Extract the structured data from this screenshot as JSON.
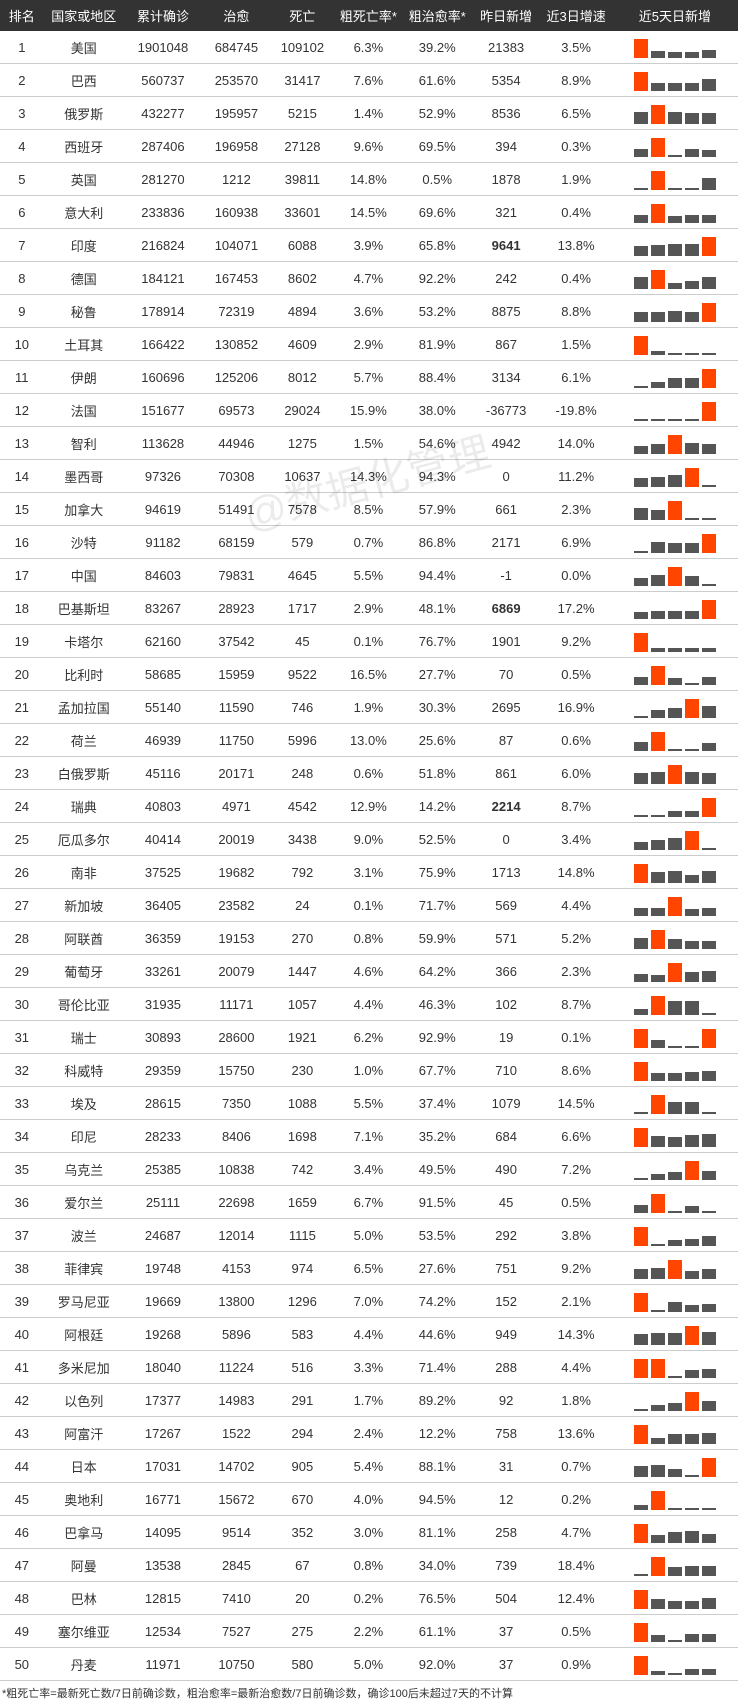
{
  "headers": [
    "排名",
    "国家或地区",
    "累计确诊",
    "治愈",
    "死亡",
    "粗死亡率*",
    "粗治愈率*",
    "昨日新增",
    "近3日增速",
    "近5天日新增"
  ],
  "footnote": "*粗死亡率=最新死亡数/7日前确诊数，粗治愈率=最新治愈数/7日前确诊数，确诊100后未超过7天的不计算",
  "rows": [
    {
      "rank": 1,
      "country": "美国",
      "conf": "1901048",
      "cure": "684745",
      "death": "109102",
      "drate": "6.3%",
      "crate": "39.2%",
      "new": "21383",
      "speed": "3.5%",
      "spark": [
        95,
        35,
        30,
        32,
        40
      ]
    },
    {
      "rank": 2,
      "country": "巴西",
      "conf": "560737",
      "cure": "253570",
      "death": "31417",
      "drate": "7.6%",
      "crate": "61.6%",
      "new": "5354",
      "speed": "8.9%",
      "spark": [
        95,
        38,
        42,
        40,
        60
      ]
    },
    {
      "rank": 3,
      "country": "俄罗斯",
      "conf": "432277",
      "cure": "195957",
      "death": "5215",
      "drate": "1.4%",
      "crate": "52.9%",
      "new": "8536",
      "speed": "6.5%",
      "spark": [
        60,
        95,
        58,
        56,
        55
      ]
    },
    {
      "rank": 4,
      "country": "西班牙",
      "conf": "287406",
      "cure": "196958",
      "death": "27128",
      "drate": "9.6%",
      "crate": "69.5%",
      "new": "394",
      "speed": "0.3%",
      "spark": [
        40,
        95,
        10,
        38,
        35
      ]
    },
    {
      "rank": 5,
      "country": "英国",
      "conf": "281270",
      "cure": "1212",
      "death": "39811",
      "drate": "14.8%",
      "crate": "0.5%",
      "new": "1878",
      "speed": "1.9%",
      "spark": [
        8,
        95,
        8,
        8,
        60
      ]
    },
    {
      "rank": 6,
      "country": "意大利",
      "conf": "233836",
      "cure": "160938",
      "death": "33601",
      "drate": "14.5%",
      "crate": "69.6%",
      "new": "321",
      "speed": "0.4%",
      "spark": [
        40,
        95,
        35,
        38,
        42
      ]
    },
    {
      "rank": 7,
      "country": "印度",
      "conf": "216824",
      "cure": "104071",
      "death": "6088",
      "drate": "3.9%",
      "crate": "65.8%",
      "new": "9641",
      "nb": true,
      "speed": "13.8%",
      "spark": [
        50,
        55,
        58,
        60,
        95
      ]
    },
    {
      "rank": 8,
      "country": "德国",
      "conf": "184121",
      "cure": "167453",
      "death": "8602",
      "drate": "4.7%",
      "crate": "92.2%",
      "new": "242",
      "speed": "0.4%",
      "spark": [
        62,
        95,
        30,
        40,
        58
      ]
    },
    {
      "rank": 9,
      "country": "秘鲁",
      "conf": "178914",
      "cure": "72319",
      "death": "4894",
      "drate": "3.6%",
      "crate": "53.2%",
      "new": "8875",
      "speed": "8.8%",
      "spark": [
        48,
        50,
        55,
        52,
        95
      ]
    },
    {
      "rank": 10,
      "country": "土耳其",
      "conf": "166422",
      "cure": "130852",
      "death": "4609",
      "drate": "2.9%",
      "crate": "81.9%",
      "new": "867",
      "speed": "1.5%",
      "spark": [
        95,
        18,
        10,
        8,
        8
      ]
    },
    {
      "rank": 11,
      "country": "伊朗",
      "conf": "160696",
      "cure": "125206",
      "death": "8012",
      "drate": "5.7%",
      "crate": "88.4%",
      "new": "3134",
      "speed": "6.1%",
      "spark": [
        8,
        32,
        50,
        52,
        95
      ]
    },
    {
      "rank": 12,
      "country": "法国",
      "conf": "151677",
      "cure": "69573",
      "death": "29024",
      "drate": "15.9%",
      "crate": "38.0%",
      "new": "-36773",
      "speed": "-19.8%",
      "spark": [
        0,
        0,
        0,
        0,
        95
      ]
    },
    {
      "rank": 13,
      "country": "智利",
      "conf": "113628",
      "cure": "44946",
      "death": "1275",
      "drate": "1.5%",
      "crate": "54.6%",
      "new": "4942",
      "speed": "14.0%",
      "spark": [
        40,
        50,
        95,
        55,
        48
      ]
    },
    {
      "rank": 14,
      "country": "墨西哥",
      "conf": "97326",
      "cure": "70308",
      "death": "10637",
      "drate": "14.3%",
      "crate": "94.3%",
      "new": "0",
      "speed": "11.2%",
      "spark": [
        45,
        50,
        60,
        95,
        8
      ]
    },
    {
      "rank": 15,
      "country": "加拿大",
      "conf": "94619",
      "cure": "51491",
      "death": "7578",
      "drate": "8.5%",
      "crate": "57.9%",
      "new": "661",
      "speed": "2.3%",
      "spark": [
        60,
        50,
        95,
        8,
        8
      ]
    },
    {
      "rank": 16,
      "country": "沙特",
      "conf": "91182",
      "cure": "68159",
      "death": "579",
      "drate": "0.7%",
      "crate": "86.8%",
      "new": "2171",
      "speed": "6.9%",
      "spark": [
        8,
        55,
        50,
        52,
        95
      ]
    },
    {
      "rank": 17,
      "country": "中国",
      "conf": "84603",
      "cure": "79831",
      "death": "4645",
      "drate": "5.5%",
      "crate": "94.4%",
      "new": "-1",
      "speed": "0.0%",
      "spark": [
        40,
        55,
        95,
        50,
        0
      ]
    },
    {
      "rank": 18,
      "country": "巴基斯坦",
      "conf": "83267",
      "cure": "28923",
      "death": "1717",
      "drate": "2.9%",
      "crate": "48.1%",
      "new": "6869",
      "nb": true,
      "speed": "17.2%",
      "spark": [
        35,
        40,
        38,
        42,
        95
      ]
    },
    {
      "rank": 19,
      "country": "卡塔尔",
      "conf": "62160",
      "cure": "37542",
      "death": "45",
      "drate": "0.1%",
      "crate": "76.7%",
      "new": "1901",
      "speed": "9.2%",
      "spark": [
        95,
        22,
        18,
        20,
        20
      ]
    },
    {
      "rank": 20,
      "country": "比利时",
      "conf": "58685",
      "cure": "15959",
      "death": "9522",
      "drate": "16.5%",
      "crate": "27.7%",
      "new": "70",
      "speed": "0.5%",
      "spark": [
        40,
        95,
        35,
        8,
        38
      ]
    },
    {
      "rank": 21,
      "country": "孟加拉国",
      "conf": "55140",
      "cure": "11590",
      "death": "746",
      "drate": "1.9%",
      "crate": "30.3%",
      "new": "2695",
      "speed": "16.9%",
      "spark": [
        8,
        40,
        50,
        95,
        60
      ]
    },
    {
      "rank": 22,
      "country": "荷兰",
      "conf": "46939",
      "cure": "11750",
      "death": "5996",
      "drate": "13.0%",
      "crate": "25.6%",
      "new": "87",
      "speed": "0.6%",
      "spark": [
        45,
        95,
        8,
        8,
        42
      ]
    },
    {
      "rank": 23,
      "country": "白俄罗斯",
      "conf": "45116",
      "cure": "20171",
      "death": "248",
      "drate": "0.6%",
      "crate": "51.8%",
      "new": "861",
      "speed": "6.0%",
      "spark": [
        55,
        60,
        95,
        58,
        55
      ]
    },
    {
      "rank": 24,
      "country": "瑞典",
      "conf": "40803",
      "cure": "4971",
      "death": "4542",
      "drate": "12.9%",
      "crate": "14.2%",
      "new": "2214",
      "nb": true,
      "speed": "8.7%",
      "spark": [
        8,
        8,
        30,
        28,
        95
      ]
    },
    {
      "rank": 25,
      "country": "厄瓜多尔",
      "conf": "40414",
      "cure": "20019",
      "death": "3438",
      "drate": "9.0%",
      "crate": "52.5%",
      "new": "0",
      "speed": "3.4%",
      "spark": [
        40,
        50,
        60,
        95,
        0
      ]
    },
    {
      "rank": 26,
      "country": "南非",
      "conf": "37525",
      "cure": "19682",
      "death": "792",
      "drate": "3.1%",
      "crate": "75.9%",
      "new": "1713",
      "speed": "14.8%",
      "spark": [
        95,
        55,
        58,
        40,
        62
      ]
    },
    {
      "rank": 27,
      "country": "新加坡",
      "conf": "36405",
      "cure": "23582",
      "death": "24",
      "drate": "0.1%",
      "crate": "71.7%",
      "new": "569",
      "speed": "4.4%",
      "spark": [
        38,
        42,
        95,
        35,
        40
      ]
    },
    {
      "rank": 28,
      "country": "阿联酋",
      "conf": "36359",
      "cure": "19153",
      "death": "270",
      "drate": "0.8%",
      "crate": "59.9%",
      "new": "571",
      "speed": "5.2%",
      "spark": [
        55,
        95,
        50,
        40,
        42
      ]
    },
    {
      "rank": 29,
      "country": "葡萄牙",
      "conf": "33261",
      "cure": "20079",
      "death": "1447",
      "drate": "4.6%",
      "crate": "64.2%",
      "new": "366",
      "speed": "2.3%",
      "spark": [
        40,
        35,
        95,
        48,
        55
      ]
    },
    {
      "rank": 30,
      "country": "哥伦比亚",
      "conf": "31935",
      "cure": "11171",
      "death": "1057",
      "drate": "4.4%",
      "crate": "46.3%",
      "new": "102",
      "speed": "8.7%",
      "spark": [
        30,
        95,
        70,
        72,
        8
      ]
    },
    {
      "rank": 31,
      "country": "瑞士",
      "conf": "30893",
      "cure": "28600",
      "death": "1921",
      "drate": "6.2%",
      "crate": "92.9%",
      "new": "19",
      "speed": "0.1%",
      "spark": [
        95,
        40,
        8,
        8,
        95
      ]
    },
    {
      "rank": 32,
      "country": "科威特",
      "conf": "29359",
      "cure": "15750",
      "death": "230",
      "drate": "1.0%",
      "crate": "67.7%",
      "new": "710",
      "speed": "8.6%",
      "spark": [
        95,
        42,
        40,
        45,
        50
      ]
    },
    {
      "rank": 33,
      "country": "埃及",
      "conf": "28615",
      "cure": "7350",
      "death": "1088",
      "drate": "5.5%",
      "crate": "37.4%",
      "new": "1079",
      "speed": "14.5%",
      "spark": [
        8,
        95,
        60,
        62,
        8
      ]
    },
    {
      "rank": 34,
      "country": "印尼",
      "conf": "28233",
      "cure": "8406",
      "death": "1698",
      "drate": "7.1%",
      "crate": "35.2%",
      "new": "684",
      "speed": "6.6%",
      "spark": [
        95,
        55,
        50,
        60,
        65
      ]
    },
    {
      "rank": 35,
      "country": "乌克兰",
      "conf": "25385",
      "cure": "10838",
      "death": "742",
      "drate": "3.4%",
      "crate": "49.5%",
      "new": "490",
      "speed": "7.2%",
      "spark": [
        8,
        30,
        38,
        95,
        45
      ]
    },
    {
      "rank": 36,
      "country": "爱尔兰",
      "conf": "25111",
      "cure": "22698",
      "death": "1659",
      "drate": "6.7%",
      "crate": "91.5%",
      "new": "45",
      "speed": "0.5%",
      "spark": [
        42,
        95,
        8,
        35,
        8
      ]
    },
    {
      "rank": 37,
      "country": "波兰",
      "conf": "24687",
      "cure": "12014",
      "death": "1115",
      "drate": "5.0%",
      "crate": "53.5%",
      "new": "292",
      "speed": "3.8%",
      "spark": [
        95,
        8,
        30,
        35,
        50
      ]
    },
    {
      "rank": 38,
      "country": "菲律宾",
      "conf": "19748",
      "cure": "4153",
      "death": "974",
      "drate": "6.5%",
      "crate": "27.6%",
      "new": "751",
      "speed": "9.2%",
      "spark": [
        50,
        55,
        95,
        40,
        52
      ]
    },
    {
      "rank": 39,
      "country": "罗马尼亚",
      "conf": "19669",
      "cure": "13800",
      "death": "1296",
      "drate": "7.0%",
      "crate": "74.2%",
      "new": "152",
      "speed": "2.1%",
      "spark": [
        95,
        8,
        50,
        35,
        40
      ]
    },
    {
      "rank": 40,
      "country": "阿根廷",
      "conf": "19268",
      "cure": "5896",
      "death": "583",
      "drate": "4.4%",
      "crate": "44.6%",
      "new": "949",
      "speed": "14.3%",
      "spark": [
        55,
        60,
        62,
        95,
        65
      ]
    },
    {
      "rank": 41,
      "country": "多米尼加",
      "conf": "18040",
      "cure": "11224",
      "death": "516",
      "drate": "3.3%",
      "crate": "71.4%",
      "new": "288",
      "speed": "4.4%",
      "spark": [
        95,
        95,
        8,
        42,
        45
      ]
    },
    {
      "rank": 42,
      "country": "以色列",
      "conf": "17377",
      "cure": "14983",
      "death": "291",
      "drate": "1.7%",
      "crate": "89.2%",
      "new": "92",
      "speed": "1.8%",
      "spark": [
        8,
        30,
        42,
        95,
        50
      ]
    },
    {
      "rank": 43,
      "country": "阿富汗",
      "conf": "17267",
      "cure": "1522",
      "death": "294",
      "drate": "2.4%",
      "crate": "12.2%",
      "new": "758",
      "speed": "13.6%",
      "spark": [
        95,
        30,
        50,
        52,
        55
      ]
    },
    {
      "rank": 44,
      "country": "日本",
      "conf": "17031",
      "cure": "14702",
      "death": "905",
      "drate": "5.4%",
      "crate": "88.1%",
      "new": "31",
      "speed": "0.7%",
      "spark": [
        55,
        60,
        40,
        8,
        95
      ]
    },
    {
      "rank": 45,
      "country": "奥地利",
      "conf": "16771",
      "cure": "15672",
      "death": "670",
      "drate": "4.0%",
      "crate": "94.5%",
      "new": "12",
      "speed": "0.2%",
      "spark": [
        25,
        95,
        10,
        10,
        10
      ]
    },
    {
      "rank": 46,
      "country": "巴拿马",
      "conf": "14095",
      "cure": "9514",
      "death": "352",
      "drate": "3.0%",
      "crate": "81.1%",
      "new": "258",
      "speed": "4.7%",
      "spark": [
        95,
        40,
        55,
        62,
        45
      ]
    },
    {
      "rank": 47,
      "country": "阿曼",
      "conf": "13538",
      "cure": "2845",
      "death": "67",
      "drate": "0.8%",
      "crate": "34.0%",
      "new": "739",
      "speed": "18.4%",
      "spark": [
        8,
        95,
        45,
        50,
        48
      ]
    },
    {
      "rank": 48,
      "country": "巴林",
      "conf": "12815",
      "cure": "7410",
      "death": "20",
      "drate": "0.2%",
      "crate": "76.5%",
      "new": "504",
      "speed": "12.4%",
      "spark": [
        95,
        50,
        42,
        40,
        55
      ]
    },
    {
      "rank": 49,
      "country": "塞尔维亚",
      "conf": "12534",
      "cure": "7527",
      "death": "275",
      "drate": "2.2%",
      "crate": "61.1%",
      "new": "37",
      "speed": "0.5%",
      "spark": [
        95,
        35,
        8,
        40,
        42
      ]
    },
    {
      "rank": 50,
      "country": "丹麦",
      "conf": "11971",
      "cure": "10750",
      "death": "580",
      "drate": "5.0%",
      "crate": "92.0%",
      "new": "37",
      "speed": "0.9%",
      "spark": [
        95,
        20,
        10,
        30,
        32
      ]
    }
  ]
}
